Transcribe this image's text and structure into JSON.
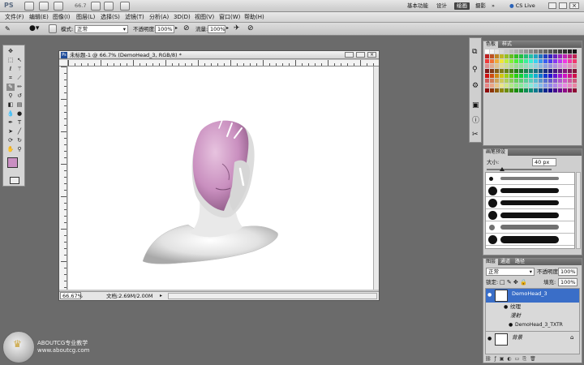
{
  "app": {
    "logo": "PS",
    "zoom": "66.7",
    "workspaces": [
      "基本功能",
      "设计",
      "绘画",
      "摄影"
    ],
    "active_workspace": "绘画",
    "cs_live": "CS Live"
  },
  "menu": [
    "文件(F)",
    "编辑(E)",
    "图像(I)",
    "图层(L)",
    "选择(S)",
    "滤镜(T)",
    "分析(A)",
    "3D(D)",
    "视图(V)",
    "窗口(W)",
    "帮助(H)"
  ],
  "options": {
    "mode_label": "模式:",
    "mode_value": "正常",
    "opacity_label": "不透明度:",
    "opacity_value": "100%",
    "flow_label": "流量:",
    "flow_value": "100%"
  },
  "document": {
    "title": "未标题-1 @ 66.7% (DemoHead_3, RGB/8) *",
    "zoom": "66.67%",
    "doc_info": "文档:2.69M/2.00M"
  },
  "color_panel": {
    "tabs": [
      "色板",
      "样式"
    ]
  },
  "brush_panel": {
    "title": "画笔预设",
    "size_label": "大小:",
    "size_value": "40 px"
  },
  "layers_panel": {
    "tabs": [
      "图层",
      "通道",
      "路径"
    ],
    "blend": "正常",
    "opacity_label": "不透明度:",
    "opacity_value": "100%",
    "lock_label": "锁定:",
    "fill_label": "填充:",
    "fill_value": "100%",
    "layers": [
      {
        "name": "DemoHead_3"
      },
      {
        "name": "纹理"
      },
      {
        "name": "漫射"
      },
      {
        "name": "DemoHead_3_TXTR"
      },
      {
        "name": "背景"
      }
    ]
  },
  "watermark": {
    "line1": "ABOUTCG专业教学",
    "line2": "www.aboutcg.com"
  }
}
